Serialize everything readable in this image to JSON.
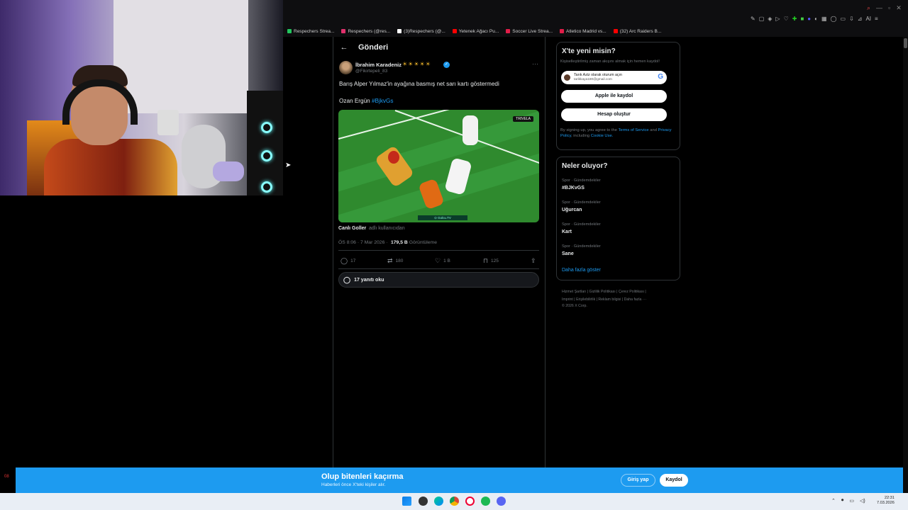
{
  "browser": {
    "bookmarks": [
      {
        "label": "Respechers Strea...",
        "color": "#22c55e"
      },
      {
        "label": "Respechers (@res...",
        "color": "#e1306c"
      },
      {
        "label": "(3)Respechers (@...",
        "color": "#ffffff"
      },
      {
        "label": "Yetenek Ağacı Pu...",
        "color": "#ff0000"
      },
      {
        "label": "Soccer Live Strea...",
        "color": "#e11d48"
      },
      {
        "label": "Atletico Madrid vs...",
        "color": "#e11d48"
      },
      {
        "label": "(32) Arc Raiders B...",
        "color": "#ff0000"
      }
    ],
    "toolbar_ai_label": "AI"
  },
  "tweet": {
    "page_title": "Gönderi",
    "author_name": "İbrahim Karadeniz",
    "author_emoji": "☀☀☀☀☀",
    "handle": "@Fikirtepeli_83",
    "text_line1": "Barış Alper Yılmaz'in ayağına basmış net sarı kartı göstermedi",
    "text_line2_prefix": "Ozan Ergün",
    "hashtag": "#BjkvGs",
    "media_tag": "TRIVELA",
    "media_logo": "⊙ Golcu.TV",
    "source_name": "Canlı Goller",
    "source_suffix": "adlı kullanıcıdan",
    "time": "ÖS 8:06 · 7 Mar 2026 ·",
    "views_count": "179,5 B",
    "views_label": "Görüntüleme",
    "actions": {
      "replies": "17",
      "reposts": "180",
      "likes": "1 B",
      "bookmarks": "125"
    },
    "read_replies": "17 yanıtı oku"
  },
  "signup": {
    "title": "X'te yeni misin?",
    "subtitle": "Kişiselleştirilmiş zaman akışını almak için hemen kaydol!",
    "google_line1": "Tarık Aziz olarak oturum açın",
    "google_line2": "tarikkaya180@gmail.com",
    "apple_label": "Apple ile kaydol",
    "create_label": "Hesap oluştur",
    "terms_prefix": "By signing up, you agree to the",
    "terms_link": "Terms of Service",
    "terms_and": "and",
    "privacy_link": "Privacy Policy",
    "terms_including": ", including",
    "cookie_link": "Cookie Use."
  },
  "trends": {
    "title": "Neler oluyor?",
    "items": [
      {
        "category": "Spor · Gündemdekiler",
        "name": "#BJKvGS"
      },
      {
        "category": "Spor · Gündemdekiler",
        "name": "Uğurcan"
      },
      {
        "category": "Spor · Gündemdekiler",
        "name": "Kart"
      },
      {
        "category": "Spor · Gündemdekiler",
        "name": "Sane"
      }
    ],
    "show_more": "Daha fazla göster"
  },
  "footer": {
    "line1": "Hizmet Şartları  |  Gizlilik Politikası  |  Çerez Politikası  |",
    "line2": "Imprint  |  Erişilebilirlik  |  Reklam bilgisi  |  Daha fazla ···",
    "line3": "© 2026 X Corp."
  },
  "banner": {
    "title": "Olup bitenleri kaçırma",
    "subtitle": "Haberleri önce X'teki kişiler alır.",
    "login": "Giriş yap",
    "register": "Kaydol"
  },
  "taskbar": {
    "time": "22:31",
    "date": "7.03.2026"
  },
  "left_strip": "08"
}
